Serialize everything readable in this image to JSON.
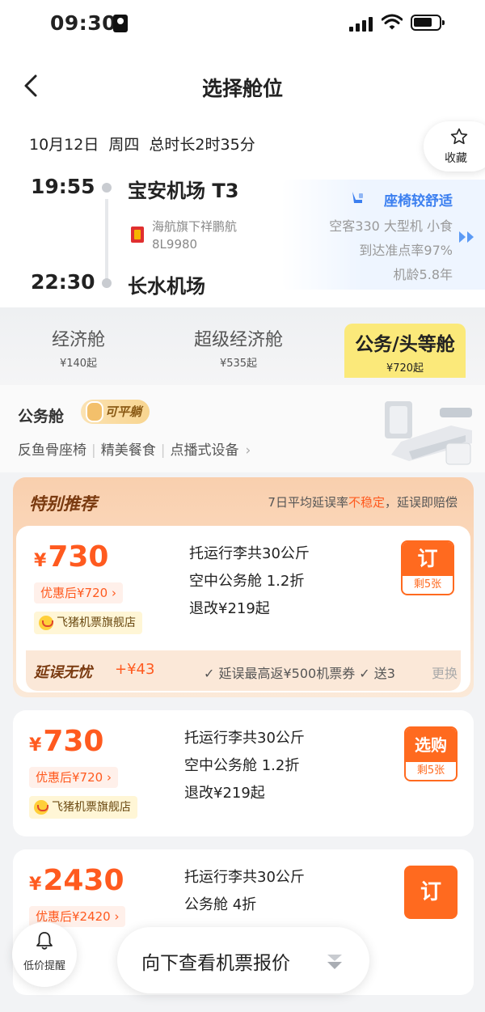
{
  "status_bar": {
    "time": "09:30"
  },
  "header": {
    "title": "选择舱位",
    "favorite_label": "收藏"
  },
  "flight": {
    "date_line": "10月12日  周四  总时长2时35分",
    "departure_time": "19:55",
    "departure_airport": "宝安机场 T3",
    "arrival_time": "22:30",
    "arrival_airport": "长水机场",
    "airline": "海航旗下祥鹏航",
    "flight_no": "8L9980",
    "comfort_title": "座椅较舒适",
    "aircraft": "空客330 大型机  小食",
    "ontime_rate": "到达准点率97%",
    "aircraft_age": "机龄5.8年"
  },
  "cabin_tabs": [
    {
      "name": "经济舱",
      "price": "¥140起",
      "active": false
    },
    {
      "name": "超级经济舱",
      "price": "¥535起",
      "active": false
    },
    {
      "name": "公务/头等舱",
      "price": "¥720起",
      "active": true
    }
  ],
  "feature": {
    "title": "公务舱",
    "badge": "可平躺",
    "items": [
      "反鱼骨座椅",
      "精美餐食",
      "点播式设备"
    ]
  },
  "recommend": {
    "title": "特别推荐",
    "note_prefix": "7日平均延误率",
    "note_warn": "不稳定",
    "note_suffix": "，延误即赔偿"
  },
  "offers": [
    {
      "price": "730",
      "discount": "优惠后¥720 ›",
      "shop": "飞猪机票旗舰店",
      "baggage": "托运行李共30公斤",
      "cabin": "空中公务舱 1.2折",
      "refund": "退改¥219起",
      "button": "订",
      "remaining": "剩5张",
      "delay": {
        "title": "延误无忧",
        "plus": "+¥43",
        "perks": "✓ 延误最高返¥500机票券  ✓ 送3",
        "more": "更换"
      }
    },
    {
      "price": "730",
      "discount": "优惠后¥720 ›",
      "shop": "飞猪机票旗舰店",
      "baggage": "托运行李共30公斤",
      "cabin": "空中公务舱 1.2折",
      "refund": "退改¥219起",
      "button": "选购",
      "remaining": "剩5张"
    },
    {
      "price": "2430",
      "discount": "优惠后¥2420 ›",
      "baggage": "托运行李共30公斤",
      "cabin": "公务舱 4折",
      "button": "订"
    }
  ],
  "floating": {
    "alert_label": "低价提醒",
    "scroll_label": "向下查看机票报价"
  },
  "currency_symbol": "¥",
  "colors": {
    "accent": "#ff5a1f",
    "tab_highlight": "#fbe97a",
    "comfort_blue": "#3b7ff0"
  }
}
